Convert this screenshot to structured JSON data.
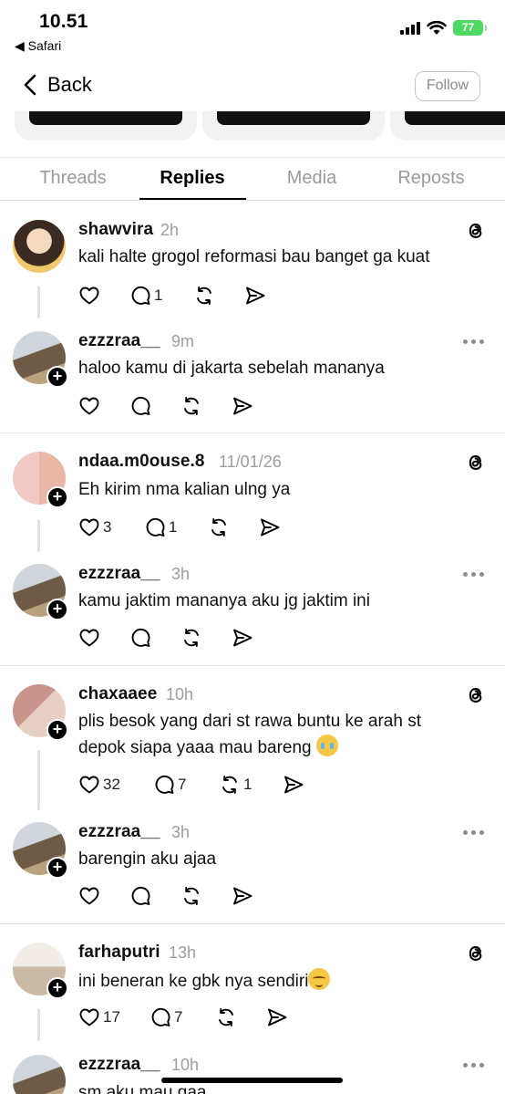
{
  "status_bar": {
    "time": "10.51",
    "back_app": "◀ Safari",
    "battery": "77"
  },
  "nav": {
    "back_label": "Back",
    "follow_label": "Follow"
  },
  "tabs": [
    {
      "label": "Threads",
      "active": false
    },
    {
      "label": "Replies",
      "active": true
    },
    {
      "label": "Media",
      "active": false
    },
    {
      "label": "Reposts",
      "active": false
    }
  ],
  "groups": [
    {
      "original": {
        "username": "shawvira",
        "time": "2h",
        "text": "kali halte grogol reformasi bau banget ga kuat",
        "likes": "",
        "replies": "1",
        "reposts": ""
      },
      "reply": {
        "username": "ezzzraa__",
        "time": "9m",
        "text": "haloo kamu di jakarta sebelah mananya",
        "likes": "",
        "replies": "",
        "reposts": ""
      }
    },
    {
      "original": {
        "username": "ndaa.m0ouse.8",
        "time": "11/01/26",
        "text": "Eh kirim nma kalian ulng ya",
        "likes": "3",
        "replies": "1",
        "reposts": ""
      },
      "reply": {
        "username": "ezzzraa__",
        "time": "3h",
        "text": "kamu jaktim mananya aku jg jaktim ini",
        "likes": "",
        "replies": "",
        "reposts": ""
      }
    },
    {
      "original": {
        "username": "chaxaaee",
        "time": "10h",
        "text_line1": "plis besok yang dari st rawa buntu ke arah st",
        "text_line2": "depok siapa yaaa mau bareng",
        "emoji": "crying-face-emoji",
        "likes": "32",
        "replies": "7",
        "reposts": "1"
      },
      "reply": {
        "username": "ezzzraa__",
        "time": "3h",
        "text": "barengin aku ajaa",
        "likes": "",
        "replies": "",
        "reposts": ""
      }
    },
    {
      "original": {
        "username": "farhaputri",
        "time": "13h",
        "text": "ini beneran ke gbk nya sendiri",
        "emoji": "relieved-face-emoji",
        "likes": "17",
        "replies": "7",
        "reposts": ""
      },
      "reply": {
        "username": "ezzzraa__",
        "time": "10h",
        "text": "sm aku mau gaa",
        "likes": "",
        "replies": "",
        "reposts": ""
      }
    }
  ],
  "colors": {
    "accent": "#000000",
    "muted": "#9d9d9d",
    "battery": "#4cd964",
    "divider": "#e3e3e3"
  }
}
